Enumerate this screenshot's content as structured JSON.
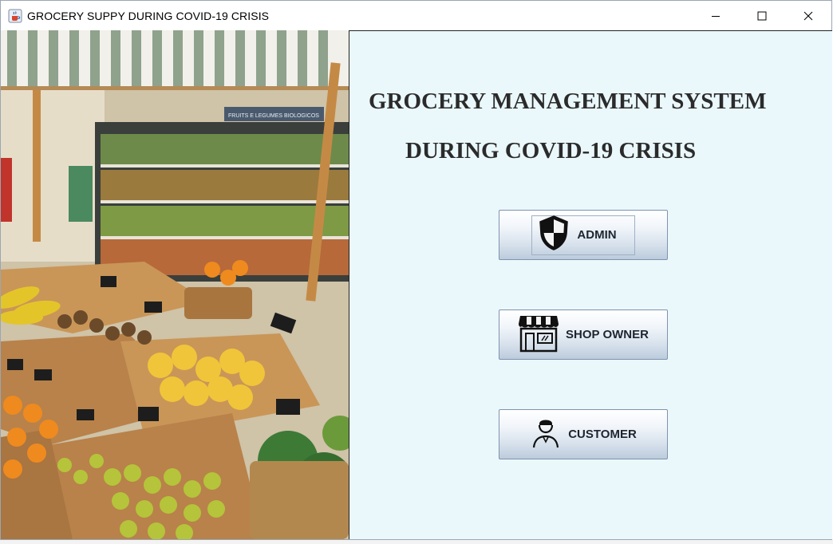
{
  "window": {
    "title": "GROCERY SUPPY DURING COVID-19 CRISIS",
    "icon": "java-cup-icon",
    "controls": [
      "minimize-icon",
      "maximize-icon",
      "close-icon"
    ]
  },
  "photo": {
    "description_icon": "grocery-market-photo",
    "signboard": "FRUITS E LEGUMES BIOLOGICOS"
  },
  "main": {
    "heading_line1": "GROCERY MANAGEMENT SYSTEM",
    "heading_line2": "DURING COVID-19 CRISIS",
    "buttons": [
      {
        "label": "ADMIN",
        "icon": "shield-icon"
      },
      {
        "label": "SHOP OWNER",
        "icon": "storefront-icon"
      },
      {
        "label": "CUSTOMER",
        "icon": "person-icon"
      }
    ]
  },
  "colors": {
    "panel_background": "#eaf8fc",
    "heading_text": "#2b2b2b",
    "button_border": "#7f93ad"
  }
}
